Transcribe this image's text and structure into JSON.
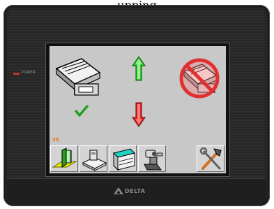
{
  "caption": "upping",
  "panel": {
    "power_label": "POWER",
    "brand_logo": "DELTA",
    "brand_color": "#8a8a8a",
    "led_color": "#c03030"
  },
  "screen": {
    "background": "#c8c8c8",
    "counter_value": "25",
    "counter_color": "#e07800",
    "saw_icon_left": "table-saw-icon",
    "saw_icon_right": "table-saw-disabled-icon",
    "status_check": "check-icon",
    "arrow_up": "green-up-arrow-icon",
    "arrow_down": "red-down-arrow-icon",
    "toolbar": [
      {
        "icon": "entry-door-icon"
      },
      {
        "icon": "saw-table-icon"
      },
      {
        "icon": "material-board-icon"
      },
      {
        "icon": "hand-tool-icon"
      },
      {
        "icon": "settings-tools-icon"
      }
    ]
  }
}
